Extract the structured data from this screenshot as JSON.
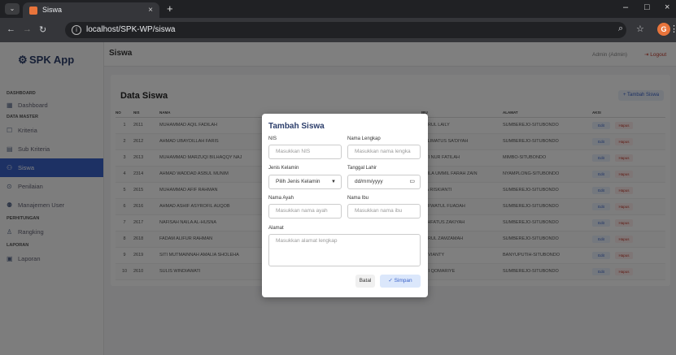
{
  "browser": {
    "tab_title": "Siswa",
    "tab_close": "×",
    "new_tab": "+",
    "url": "localhost/SPK-WP/siswa",
    "min": "–",
    "max": "□",
    "close": "×"
  },
  "sidebar": {
    "brand": "SPK App",
    "sections": {
      "dashboard": "DASHBOARD",
      "data_master": "DATA MASTER",
      "perhitungan": "PERHITUNGAN",
      "laporan": "LAPORAN"
    },
    "items": [
      {
        "label": "Dashboard"
      },
      {
        "label": "Kriteria"
      },
      {
        "label": "Sub Kriteria"
      },
      {
        "label": "Siswa"
      },
      {
        "label": "Penilaian"
      },
      {
        "label": "Manajemen User"
      },
      {
        "label": "Rangking"
      },
      {
        "label": "Laporan"
      }
    ]
  },
  "topbar": {
    "title": "Siswa",
    "user": "Admin (Admin)",
    "logout": "Logout"
  },
  "card": {
    "title": "Data Siswa",
    "add_button": "+ Tambah Siswa",
    "columns": [
      "NO",
      "NIS",
      "NAMA",
      "",
      "",
      "IBU",
      "ALAMAT",
      "AKSI"
    ],
    "edit_label": "Edit",
    "hapus_label": "Hapus",
    "rows": [
      {
        "no": "1",
        "nis": "2611",
        "nama": "MUHAMMAD AQIL FADILAH",
        "ibu": "NURUL LAILY",
        "alamat": "SUMBEREJO-SITUBONDO"
      },
      {
        "no": "2",
        "nis": "2612",
        "nama": "AHMAD UBAYDILLAH FARIS",
        "ibu": "HALIMATUS SA'DIYAH",
        "alamat": "SUMBEREJO-SITUBONDO"
      },
      {
        "no": "3",
        "nis": "2613",
        "nama": "MUHAMMAD MARZUQI BILHAQQY NAJ",
        "ibu": "SITI NUR FATILAH",
        "alamat": "MIMBO-SITUBONDO"
      },
      {
        "no": "4",
        "nis": "2314",
        "nama": "AHMAD WADDAD ASBUL MUNIM",
        "ibu": "NAILA UMMIL FARAH ZAIN",
        "alamat": "NYAMPLONG-SITUBONDO"
      },
      {
        "no": "5",
        "nis": "2615",
        "nama": "MUHAMMAD AFIF RAHMAN",
        "ibu": "NIA RISKIANTI",
        "alamat": "SUMBEREJO-SITUBONDO"
      },
      {
        "no": "6",
        "nis": "2616",
        "nama": "AHMAD ASHIF ASYROFIL AUQOB",
        "ibu": "SOFWATUL FUADAH",
        "alamat": "SUMBEREJO-SITUBONDO"
      },
      {
        "no": "7",
        "nis": "2617",
        "nama": "NAFISAH NAILA AL-HUSNA",
        "ibu": "TUHFATUS ZAKIYAH",
        "alamat": "SUMBEREJO-SITUBONDO"
      },
      {
        "no": "8",
        "nis": "2618",
        "nama": "FADAM ALIFUR RAHMAN",
        "ibu": "NURUL ZAMZAMAH",
        "alamat": "SUMBEREJO-SITUBONDO"
      },
      {
        "no": "9",
        "nis": "2619",
        "nama": "SITI MUTMAINNAH AMALIA SHOLEHA",
        "ibu": "NOVIANTY",
        "alamat": "BANYUPUTIH-SITUBONDO"
      },
      {
        "no": "10",
        "nis": "2610",
        "nama": "SULIS WINDIAWATI",
        "ibu": "SITI QOMARIYE",
        "alamat": "SUMBEREJO-SITUBONDO"
      }
    ]
  },
  "modal": {
    "title": "Tambah Siswa",
    "nis_label": "NIS",
    "nis_placeholder": "Masukkan NIS",
    "nama_label": "Nama Lengkap",
    "nama_placeholder": "Masukkan nama lengka",
    "jk_label": "Jenis Kelamin",
    "jk_value": "Pilih Jenis Kelamin",
    "tgl_label": "Tanggal Lahir",
    "tgl_value": "dd/mm/yyyy",
    "ayah_label": "Nama Ayah",
    "ayah_placeholder": "Masukkan nama ayah",
    "ibu_label": "Nama Ibu",
    "ibu_placeholder": "Masukkan nama ibu",
    "alamat_label": "Alamat",
    "alamat_placeholder": "Masukkan alamat lengkap",
    "batal": "Batal",
    "simpan": "✓ Simpan"
  }
}
